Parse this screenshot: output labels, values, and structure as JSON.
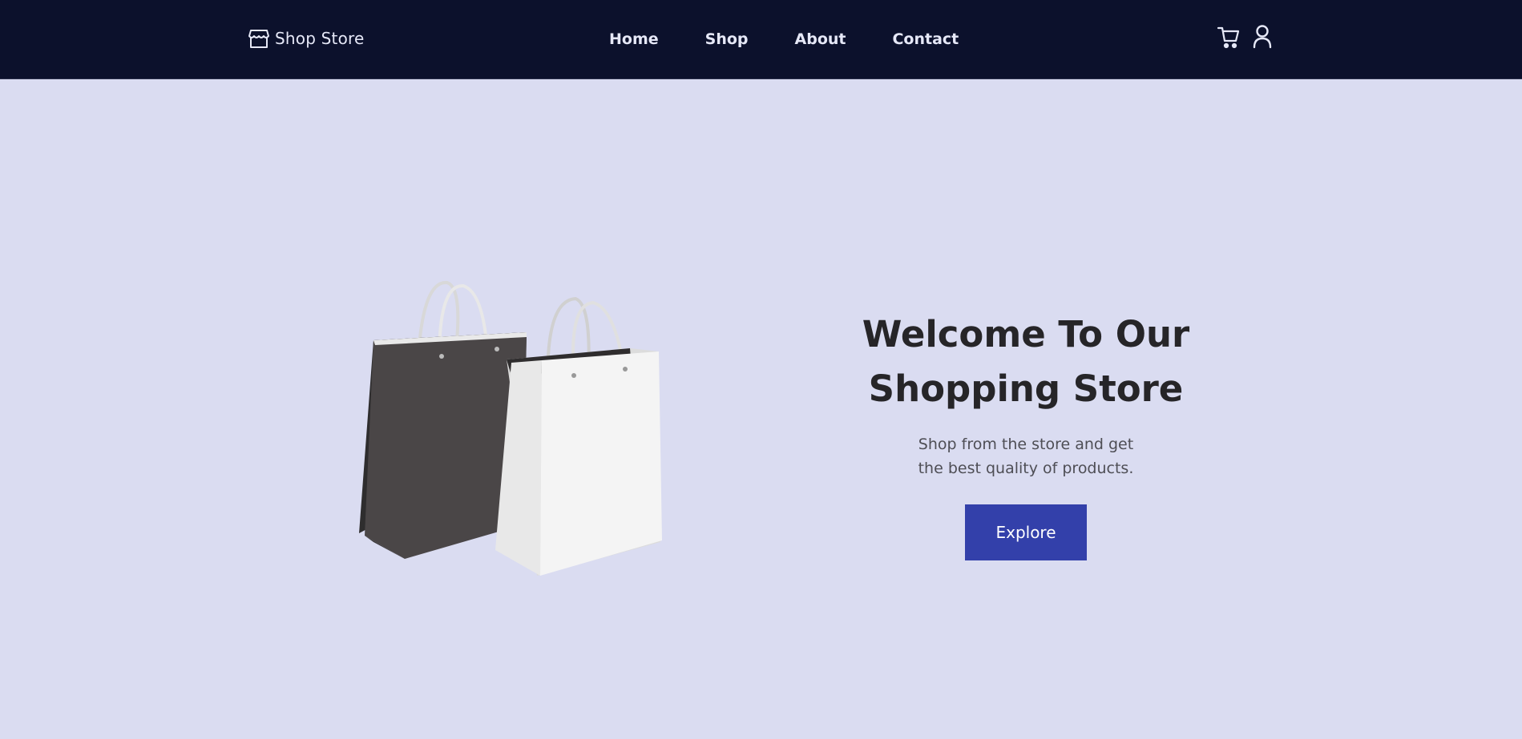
{
  "brand": {
    "name": "Shop Store",
    "icon": "store-icon"
  },
  "nav": {
    "links": [
      {
        "label": "Home"
      },
      {
        "label": "Shop"
      },
      {
        "label": "About"
      },
      {
        "label": "Contact"
      }
    ],
    "icons": [
      "cart-icon",
      "user-icon"
    ]
  },
  "hero": {
    "title": "Welcome To Our Shopping Store",
    "subtitle": "Shop from the store and get the best quality of products.",
    "button_label": "Explore",
    "image": "shopping-bags-image"
  },
  "colors": {
    "navbar": "#0c112c",
    "page_background": "#dadcf1",
    "button": "#3340aa",
    "title_text": "#262528"
  }
}
